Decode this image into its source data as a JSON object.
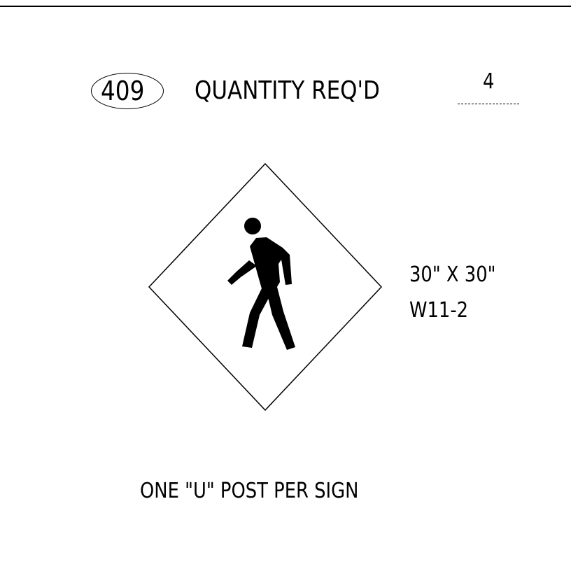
{
  "sheet": {
    "sign_number": "409",
    "quantity_label": "QUANTITY REQ'D",
    "quantity_value": "4"
  },
  "sign": {
    "size": "30\" X 30\"",
    "code": "W11-2",
    "shape": "diamond",
    "symbol_icon": "pedestrian-icon",
    "colors": {
      "face": "#ffffff",
      "border": "#000000",
      "symbol": "#000000"
    }
  },
  "note": {
    "text": "ONE \"U\" POST PER SIGN"
  }
}
